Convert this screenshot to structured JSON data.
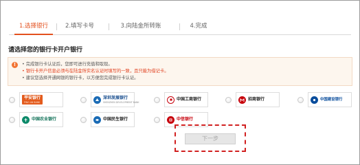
{
  "steps": [
    {
      "label": "1.选择银行",
      "active": true
    },
    {
      "label": "2.填写卡号",
      "active": false
    },
    {
      "label": "3.向陆金所转账",
      "active": false
    },
    {
      "label": "4.完成",
      "active": false
    }
  ],
  "section_title": "请选择您的银行卡开户银行",
  "notice": {
    "icon": "exclamation-icon",
    "line1": "• 完成银行卡认证后，您即可进行充值和取现。",
    "line2": "• 银行卡开户信息必须与在陆金所实名认证时填写的一致，且只能为借记卡。",
    "line3": "• 建议您选择开通网银的银行卡，以方便您完成银行卡认证。"
  },
  "banks": [
    {
      "name": "平安银行",
      "sub": "PING AN BANK",
      "color": "#e35b1d",
      "boxed": true
    },
    {
      "name": "深圳发展银行",
      "sub": "SHENZHEN DEVELOPMENT BANK",
      "color": "#1a6bb5",
      "boxed": false
    },
    {
      "name": "中国工商银行",
      "sub": "",
      "color": "#c7000b",
      "boxed": false
    },
    {
      "name": "招商银行",
      "sub": "",
      "color": "#c7000b",
      "boxed": false
    },
    {
      "name": "中国建设银行",
      "sub": "",
      "color": "#0a4d9c",
      "boxed": false
    },
    {
      "name": "中国农业银行",
      "sub": "",
      "color": "#0d8a6a",
      "boxed": false
    },
    {
      "name": "中国民生银行",
      "sub": "",
      "color": "#1a6bb5",
      "boxed": false
    },
    {
      "name": "中信银行",
      "sub": "",
      "color": "#c7000b",
      "boxed": false
    }
  ],
  "next_button": "下一步"
}
